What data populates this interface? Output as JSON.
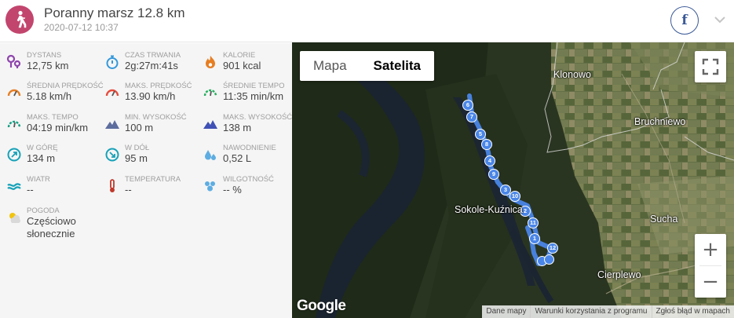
{
  "header": {
    "title": "Poranny marsz 12.8 km",
    "date": "2020-07-12 10:37",
    "share_icon": "facebook-icon",
    "share_glyph": "f"
  },
  "stats": [
    {
      "key": "distance",
      "label": "DYSTANS",
      "value": "12,75 km",
      "icon": "distance-icon",
      "color": "#8e44ad"
    },
    {
      "key": "duration",
      "label": "CZAS TRWANIA",
      "value": "2g:27m:41s",
      "icon": "stopwatch-icon",
      "color": "#3498db"
    },
    {
      "key": "calories",
      "label": "KALORIE",
      "value": "901 kcal",
      "icon": "flame-icon",
      "color": "#e67e22"
    },
    {
      "key": "avg_speed",
      "label": "ŚREDNIA PRĘDKOŚĆ",
      "value": "5.18 km/h",
      "icon": "speedometer-icon",
      "color": "#e67e22"
    },
    {
      "key": "max_speed",
      "label": "MAKS. PRĘDKOŚĆ",
      "value": "13.90 km/h",
      "icon": "speedometer-icon",
      "color": "#e74c3c"
    },
    {
      "key": "avg_pace",
      "label": "ŚREDNIE TEMPO",
      "value": "11:35 min/km",
      "icon": "pace-icon",
      "color": "#27ae60"
    },
    {
      "key": "max_pace",
      "label": "MAKS. TEMPO",
      "value": "04:19 min/km",
      "icon": "pace-icon",
      "color": "#16a085"
    },
    {
      "key": "min_alt",
      "label": "MIN. WYSOKOŚĆ",
      "value": "100 m",
      "icon": "mountain-icon",
      "color": "#5d6d9e"
    },
    {
      "key": "max_alt",
      "label": "MAKS. WYSOKOŚĆ",
      "value": "138 m",
      "icon": "mountain-icon",
      "color": "#3f51b5"
    },
    {
      "key": "ascent",
      "label": "W GÓRĘ",
      "value": "134 m",
      "icon": "compass-up-icon",
      "color": "#17a2b8"
    },
    {
      "key": "descent",
      "label": "W DÓŁ",
      "value": "95 m",
      "icon": "compass-down-icon",
      "color": "#17a2b8"
    },
    {
      "key": "hydration",
      "label": "NAWODNIENIE",
      "value": "0,52 L",
      "icon": "water-drops-icon",
      "color": "#5dade2"
    },
    {
      "key": "wind",
      "label": "WIATR",
      "value": "--",
      "icon": "wind-icon",
      "color": "#17a2b8"
    },
    {
      "key": "temperature",
      "label": "TEMPERATURA",
      "value": "--",
      "icon": "thermometer-icon",
      "color": "#c0392b"
    },
    {
      "key": "humidity",
      "label": "WILGOTNOŚĆ",
      "value": "-- %",
      "icon": "humidity-icon",
      "color": "#5dade2"
    },
    {
      "key": "weather",
      "label": "POGODA",
      "value": "Częściowo\nsłonecznie",
      "icon": "partly-sunny-icon",
      "color": "#f1c40f"
    }
  ],
  "map": {
    "type_buttons": [
      "Mapa",
      "Satelita"
    ],
    "selected_type": "Satelita",
    "places": [
      "Klonowo",
      "Bruchniewo",
      "Sokole-Kuźnica",
      "Sucha",
      "Cierplewo"
    ],
    "markers": [
      "6",
      "7",
      "5",
      "8",
      "4",
      "9",
      "3",
      "10",
      "2",
      "11",
      "1",
      "12"
    ],
    "zoom_in": "+",
    "zoom_out": "−",
    "attribution_logo": "Google",
    "footer_links": [
      "Dane mapy",
      "Warunki korzystania z programu",
      "Zgłoś błąd w mapach"
    ],
    "route_color": "#4a86e8"
  }
}
